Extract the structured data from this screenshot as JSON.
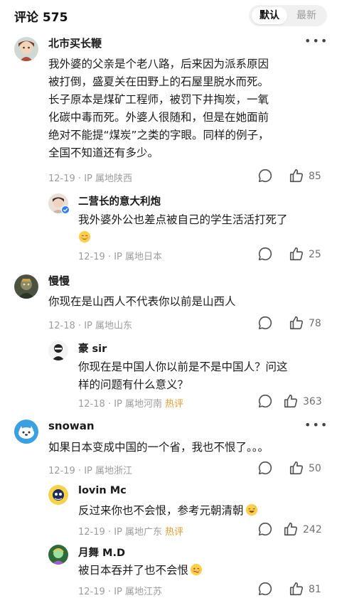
{
  "header": {
    "title": "评论 575",
    "tab_default": "默认",
    "tab_latest": "最新"
  },
  "comments": [
    {
      "author": "北市买长鞭",
      "lines": [
        "我外婆的父亲是个老八路，后来因为派系原因",
        "被打倒，盛夏关在田野上的石屋里脱水而死。",
        "长子原本是煤矿工程师，被罚下井掏炭，一氧",
        "化碳中毒而死。外婆人很随和，但是在她面前",
        "绝对不能提“煤炭”之类的字眼。同样的例子，",
        "全国不知道还有多少。"
      ],
      "date": "12-19",
      "ip": "IP 属地陕西",
      "likes": "85"
    },
    {
      "author": "二营长的意大利炮",
      "lines": [
        "我外婆外公也差点被自己的学生活活打死了"
      ],
      "emoji": "relieved-face-emoji",
      "date": "12-19",
      "ip": "IP 属地日本",
      "likes": "25"
    },
    {
      "author": "慢慢",
      "lines": [
        "你现在是山西人不代表你以前是山西人"
      ],
      "date": "12-18",
      "ip": "IP 属地山东",
      "likes": "78"
    },
    {
      "author": "豪 sir",
      "lines": [
        "你现在是中国人你以前是不是中国人？问这",
        "样的问题有什么意义？"
      ],
      "date": "12-18",
      "ip": "IP 属地河南",
      "hot": "热评",
      "likes": "363"
    },
    {
      "author": "snowan",
      "lines": [
        "如果日本变成中国的一个省，我也不恨了。。。"
      ],
      "date": "12-19",
      "ip": "IP 属地浙江",
      "likes": "50"
    },
    {
      "author": "lovin Mc",
      "lines": [
        "反过来你也不会恨，参考元朝清朝"
      ],
      "emoji": "grinning-sweat-emoji",
      "date": "12-19",
      "ip": "IP 属地广东",
      "hot": "热评",
      "likes": "242"
    },
    {
      "author": "月舞 M.D",
      "lines": [
        "被日本吞并了也不会恨"
      ],
      "emoji": "woozy-face-emoji",
      "date": "12-19",
      "ip": "IP 属地江苏",
      "likes": "81"
    }
  ],
  "colors": {
    "hot": "#e89a2c",
    "meta": "#9c9c9c",
    "verified": "#2f7cf6"
  },
  "icons": [
    "more-icon",
    "reply-icon",
    "like-icon",
    "verified-icon"
  ]
}
